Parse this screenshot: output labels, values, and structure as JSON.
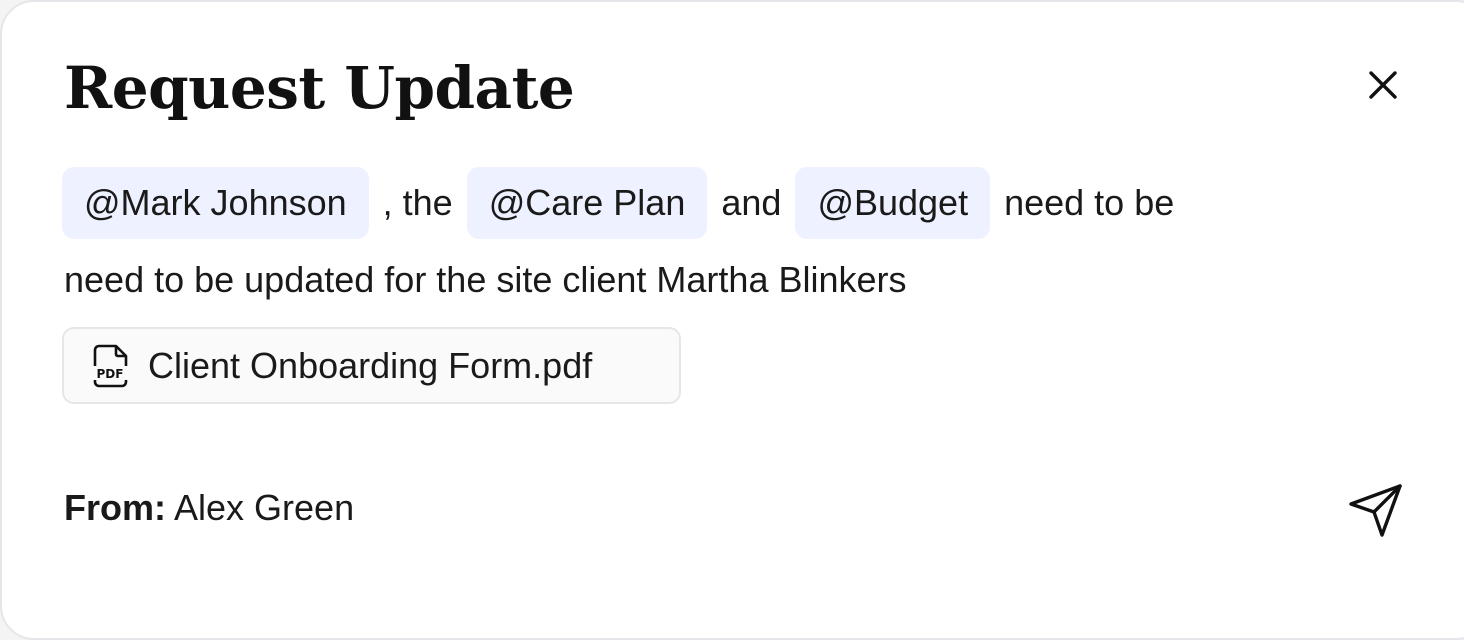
{
  "dialog": {
    "title": "Request Update",
    "close_icon": "close-icon"
  },
  "message": {
    "mentions": [
      {
        "label": "@Mark Johnson"
      },
      {
        "label": "@Care Plan"
      },
      {
        "label": "@Budget"
      }
    ],
    "connectors": [
      ", the",
      "and",
      "need to be"
    ],
    "line2": "need to be updated for the site client Martha Blinkers"
  },
  "attachment": {
    "icon": "pdf-file-icon",
    "icon_text": "PDF",
    "filename": "Client Onboarding Form.pdf"
  },
  "footer": {
    "from_label": "From:",
    "from_name": "Alex Green",
    "send_icon": "send-icon"
  },
  "colors": {
    "mention_bg": "#eef1ff",
    "attachment_bg": "#fafafb",
    "border": "#e6e6ea",
    "text": "#111111"
  }
}
